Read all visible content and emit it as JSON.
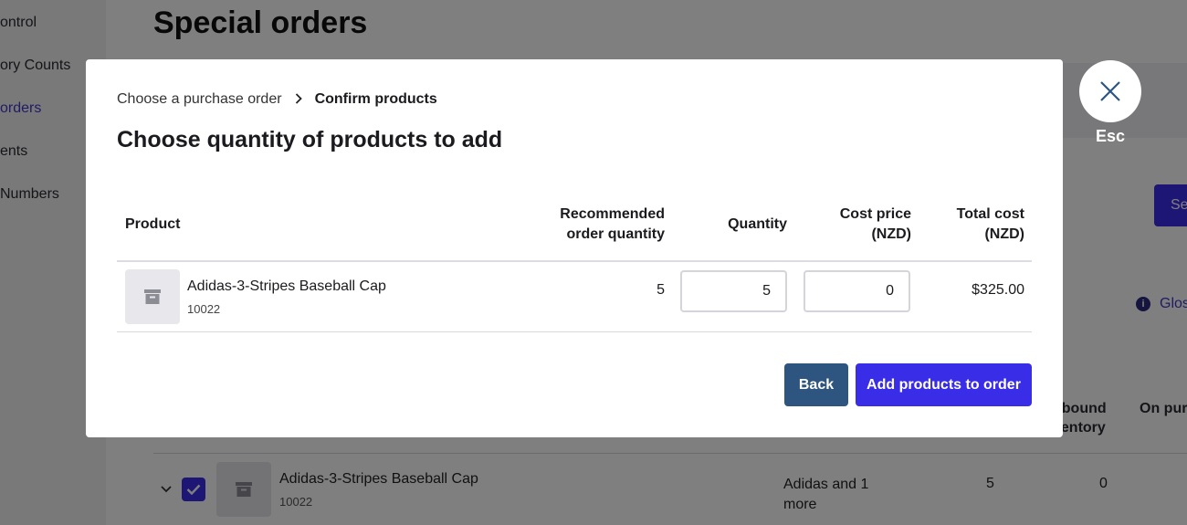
{
  "sidebar": {
    "items": [
      {
        "label": "ontrol",
        "active": false
      },
      {
        "label": "ory Counts",
        "active": false
      },
      {
        "label": " orders",
        "active": true
      },
      {
        "label": "ents",
        "active": false
      },
      {
        "label": "Numbers",
        "active": false
      }
    ]
  },
  "page": {
    "title": "Special orders",
    "search_button": "Sea",
    "glossary_link": "Glos",
    "columns": {
      "inbound_line1": "nbound",
      "inbound_line2": "ventory",
      "on_purchase": "On purc"
    },
    "row": {
      "product_name": "Adidas-3-Stripes Baseball Cap",
      "sku": "10022",
      "supplier": "Adidas and 1 more",
      "value1": "5",
      "value2": "0",
      "checked": true
    }
  },
  "modal": {
    "breadcrumb": {
      "step1": "Choose a purchase order",
      "step2": "Confirm products"
    },
    "title": "Choose quantity of products to add",
    "table": {
      "headers": {
        "product": "Product",
        "recommended_line1": "Recommended",
        "recommended_line2": "order quantity",
        "quantity": "Quantity",
        "cost_line1": "Cost price",
        "cost_line2": "(NZD)",
        "total_line1": "Total cost",
        "total_line2": "(NZD)"
      },
      "rows": [
        {
          "product_name": "Adidas-3-Stripes Baseball Cap",
          "sku": "10022",
          "recommended_qty": "5",
          "quantity": "5",
          "cost_price": "0",
          "total_cost": "$325.00"
        }
      ]
    },
    "buttons": {
      "back": "Back",
      "add": "Add products to order"
    },
    "close": {
      "icon": "close-icon",
      "label": "Esc"
    }
  },
  "colors": {
    "accent": "#3a2de8",
    "back_button": "#2d5580",
    "link": "#3f37c9"
  }
}
